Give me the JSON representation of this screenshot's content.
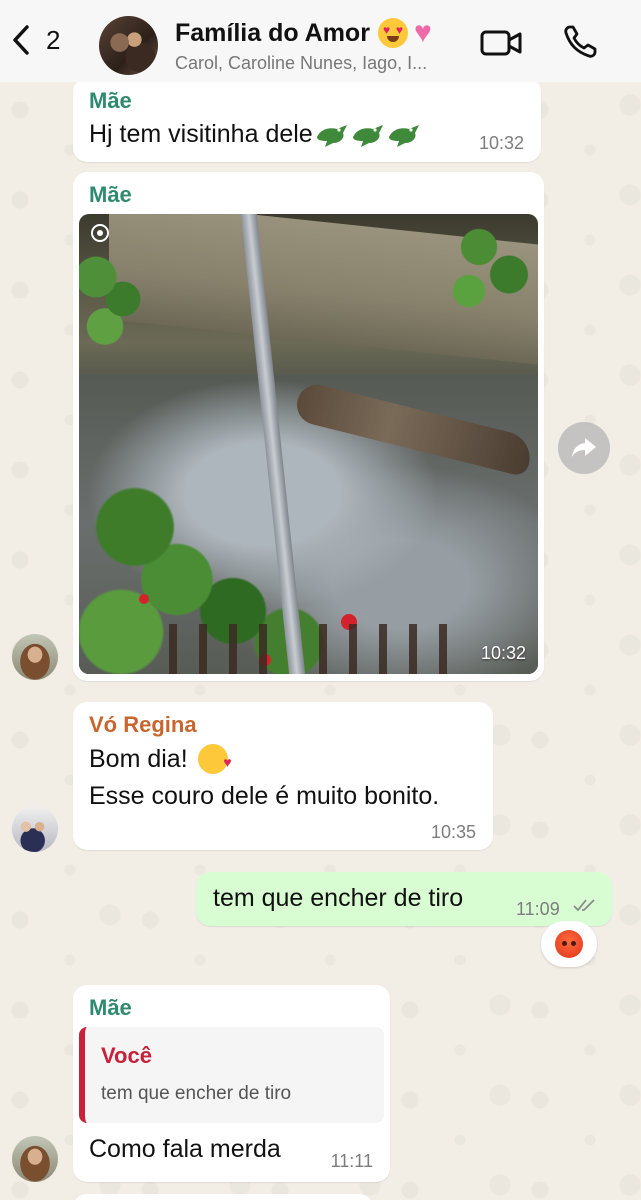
{
  "header": {
    "back_count": "2",
    "title": "Família do Amor",
    "title_emojis": [
      "heart-eyes-emoji",
      "sparkling-heart-emoji"
    ],
    "subtitle": "Carol, Caroline Nunes, Iago, I..."
  },
  "messages": [
    {
      "sender": "Mãe",
      "text": "Hj tem visitinha dele",
      "emojis": [
        "crocodile",
        "crocodile",
        "crocodile"
      ],
      "time": "10:32"
    },
    {
      "sender": "Mãe",
      "type": "photo",
      "time": "10:32"
    },
    {
      "sender": "Vó Regina",
      "line1": "Bom dia!",
      "line1_emoji": "kissing-face-emoji",
      "line2": "Esse couro dele é muito bonito.",
      "time": "10:35"
    },
    {
      "outgoing": true,
      "text": "tem que encher de tiro",
      "time": "11:09",
      "reaction": "angry-face-emoji"
    },
    {
      "sender": "Mãe",
      "quote": {
        "name": "Você",
        "text": "tem que encher de tiro"
      },
      "text": "Como fala merda",
      "time": "11:11"
    }
  ],
  "colors": {
    "outgoing_bubble": "#d9fdd3",
    "sender_mae": "#2f8b6e",
    "sender_vo": "#c8662f",
    "quote_accent": "#c8223a",
    "icon_blue": "#111111"
  }
}
